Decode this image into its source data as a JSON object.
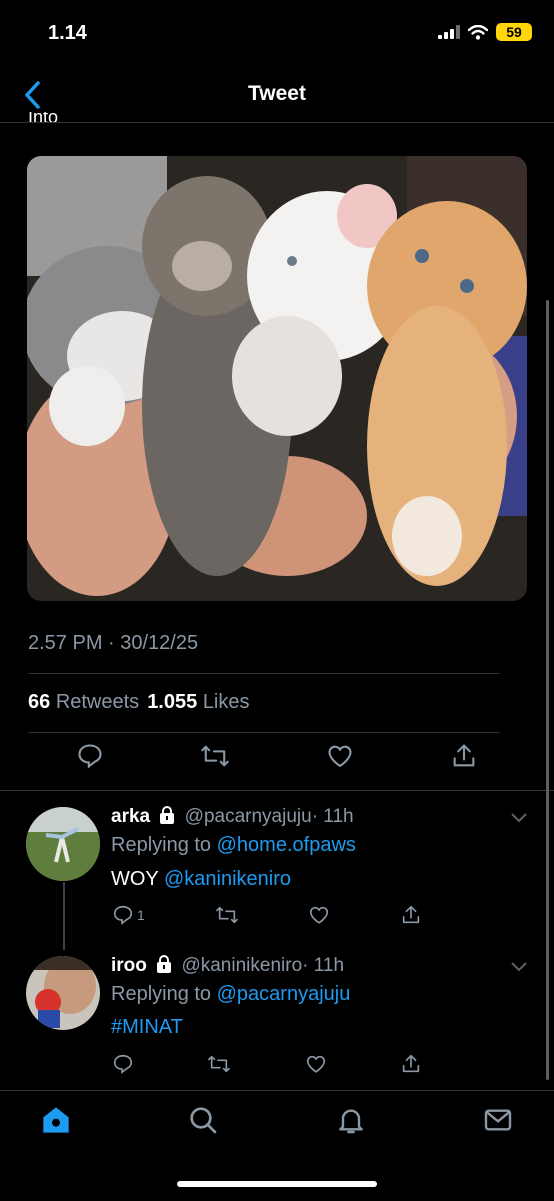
{
  "status_bar": {
    "time": "1.14",
    "battery": "59"
  },
  "header": {
    "title": "Tweet",
    "cut_text": "Into"
  },
  "tweet": {
    "timestamp": "2.57 PM · 30/12/25",
    "retweets_count": "66",
    "retweets_label": "Retweets",
    "likes_count": "1.055",
    "likes_label": "Likes"
  },
  "replies": [
    {
      "name": "arka",
      "handle": "@pacarnyajuju",
      "time": "· 11h",
      "replying_prefix": "Replying to",
      "replying_to": "@home.ofpaws",
      "text_plain": "WOY",
      "text_link": "@kaninikeniro",
      "reply_count": "1"
    },
    {
      "name": "iroo",
      "handle": "@kaninikeniro",
      "time": "· 11h",
      "replying_prefix": "Replying to",
      "replying_to": "@pacarnyajuju",
      "text_link": "#MINAT"
    }
  ],
  "colors": {
    "accent": "#1d9bf0",
    "muted": "#8b98a5",
    "background": "#000000",
    "battery": "#ffd60a"
  }
}
